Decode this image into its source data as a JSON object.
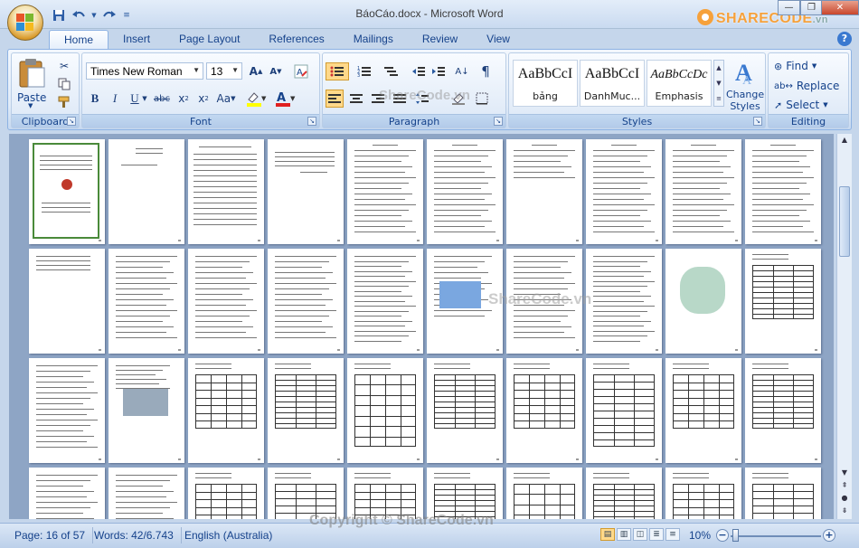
{
  "window": {
    "title": "BáoCáo.docx - Microsoft Word",
    "brand": "SHARECODE",
    "brand_suffix": ".vn"
  },
  "quick_access": [
    "save-icon",
    "undo-icon",
    "redo-icon",
    "customize-icon"
  ],
  "tabs": [
    "Home",
    "Insert",
    "Page Layout",
    "References",
    "Mailings",
    "Review",
    "View"
  ],
  "active_tab": "Home",
  "ribbon": {
    "clipboard": {
      "label": "Clipboard",
      "paste": "Paste"
    },
    "font": {
      "label": "Font",
      "family": "Times New Roman",
      "size": "13"
    },
    "paragraph": {
      "label": "Paragraph"
    },
    "styles": {
      "label": "Styles",
      "cards": [
        {
          "sample": "AaBbCcI",
          "name": "bảng"
        },
        {
          "sample": "AaBbCcI",
          "name": "DanhMuc..."
        },
        {
          "sample": "AaBbCcDc",
          "name": "Emphasis"
        }
      ],
      "change_styles_line1": "Change",
      "change_styles_line2": "Styles"
    },
    "editing": {
      "label": "Editing",
      "find": "Find",
      "replace": "Replace",
      "select": "Select"
    }
  },
  "watermarks": {
    "doc": "ShareCode.vn",
    "ribbon": "ShareCode.vn",
    "copyright": "Copyright © ShareCode.vn"
  },
  "status": {
    "page": "Page: 16 of 57",
    "words": "Words: 42/6.743",
    "language": "English (Australia)",
    "zoom": "10%"
  },
  "colors": {
    "accent": "#15428b",
    "ribbon_bg": "#dbe7f6",
    "highlight": "#ffd98a"
  }
}
